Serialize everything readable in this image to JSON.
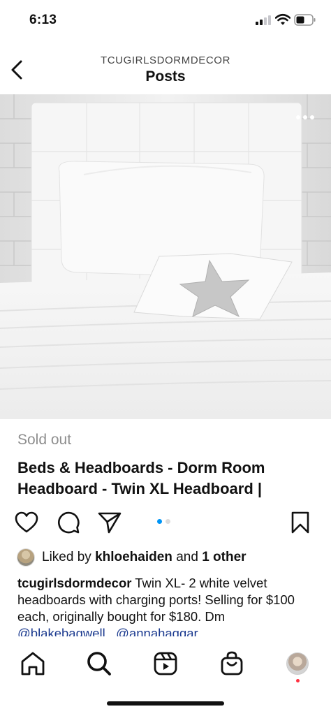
{
  "status_bar": {
    "time": "6:13"
  },
  "header": {
    "account": "TCUGIRLSDORMDECOR",
    "title": "Posts",
    "back_icon": "chevron-left-icon"
  },
  "post": {
    "more_icon": "more-horizontal-icon",
    "status": "Sold out",
    "product_title": "Beds & Headboards - Dorm Room Headboard - Twin XL Headboard |",
    "carousel": {
      "count": 2,
      "active": 1,
      "active_color": "#0095f6",
      "inactive_color": "#dbdbdb"
    },
    "actions": {
      "like_icon": "heart-icon",
      "comment_icon": "comment-icon",
      "share_icon": "send-icon",
      "save_icon": "bookmark-icon"
    },
    "likes": {
      "prefix": "Liked by",
      "user": "khloehaiden",
      "middle": "and",
      "others": "1 other"
    },
    "caption": {
      "user": "tcugirlsdormdecor",
      "text": "Twin XL- 2 white velvet headboards with charging ports! Selling for $100 each, originally bought for $180. Dm",
      "mention1": "@blakebagwell",
      "mention2": "@annahaggar"
    }
  },
  "bottom_nav": {
    "items": [
      "home-icon",
      "search-icon",
      "reels-icon",
      "shop-icon",
      "profile-avatar"
    ],
    "notification_color": "#ff3040"
  }
}
